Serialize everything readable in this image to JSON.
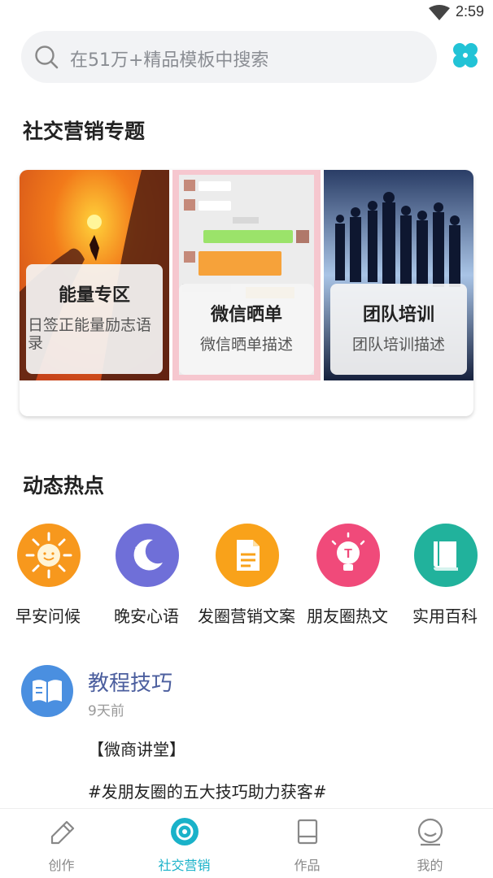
{
  "status_bar": {
    "time": "2:59"
  },
  "search": {
    "placeholder": "在51万+精品模板中搜索"
  },
  "sections": {
    "social": "社交营销专题",
    "hot": "动态热点"
  },
  "topics": [
    {
      "title": "能量专区",
      "desc": "日签正能量励志语录"
    },
    {
      "title": "微信晒单",
      "desc": "微信晒单描述"
    },
    {
      "title": "团队培训",
      "desc": "团队培训描述"
    }
  ],
  "hot_items": [
    {
      "label": "早安问候",
      "icon": "sun-icon",
      "color": "#f7981d"
    },
    {
      "label": "晚安心语",
      "icon": "moon-icon",
      "color": "#6f6fd8"
    },
    {
      "label": "发圈营销文案",
      "icon": "document-icon",
      "color": "#f9a21a"
    },
    {
      "label": "朋友圈热文",
      "icon": "lightbulb-icon",
      "color": "#f04a7a"
    },
    {
      "label": "实用百科",
      "icon": "book-icon",
      "color": "#21b29c"
    }
  ],
  "post": {
    "name": "教程技巧",
    "time": "9天前",
    "line1": "【微商讲堂】",
    "line2": "#发朋友圈的五大技巧助力获客#"
  },
  "tabs": [
    {
      "label": "创作",
      "icon": "pencil-icon"
    },
    {
      "label": "社交营销",
      "icon": "camera-shutter-icon"
    },
    {
      "label": "作品",
      "icon": "notebook-icon"
    },
    {
      "label": "我的",
      "icon": "smiley-icon"
    }
  ],
  "colors": {
    "accent": "#1ab2c9"
  }
}
